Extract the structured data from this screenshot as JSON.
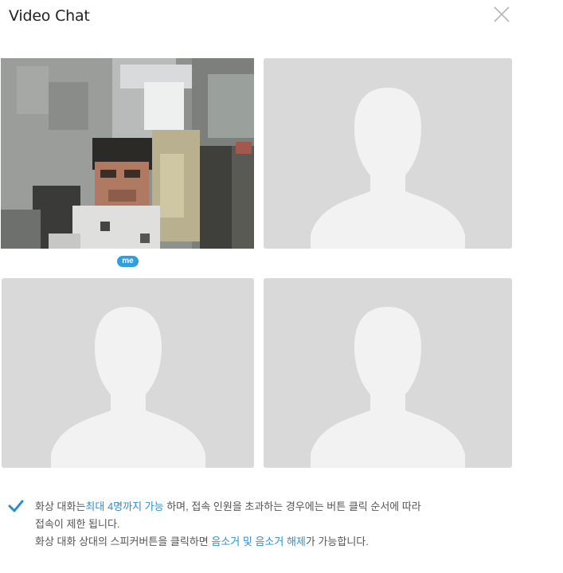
{
  "window": {
    "title": "Video Chat"
  },
  "tiles": {
    "self": {
      "badge": "me"
    },
    "peer_count_empty": 3
  },
  "notice": {
    "line1_prefix": "화상 대화는",
    "line1_highlight": "최대 4명까지 가능",
    "line1_suffix": " 하며, 접속 인원을 초과하는 경우에는 버튼 클릭 순서에 따라",
    "line2": "접속이 제한 됩니다.",
    "line3_prefix": "화상 대화 상대의 스피커버튼을 클릭하면 ",
    "line3_highlight": "음소거 및 음소거 해제",
    "line3_suffix": "가 가능합니다."
  },
  "colors": {
    "accent": "#2a8fd0",
    "badge": "#2f9fe0",
    "tile_bg": "#d9d9d9",
    "avatar": "#f2f2f2"
  },
  "icons": {
    "close": "close-icon",
    "check": "check-icon",
    "avatar": "avatar-placeholder-icon"
  }
}
